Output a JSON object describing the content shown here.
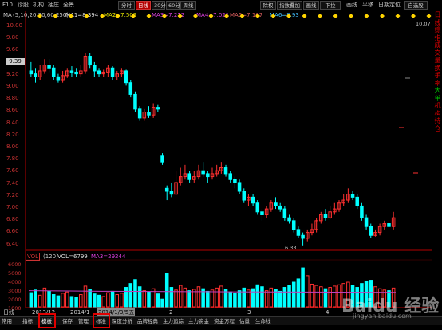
{
  "toolbar": {
    "left_items": [
      "F10",
      "诊股",
      "机构",
      "抽庄",
      "全景"
    ],
    "period_buttons": [
      {
        "label": "分时",
        "active": false
      },
      {
        "label": "日线",
        "active": true
      },
      {
        "label": "30分",
        "active": false
      },
      {
        "label": "60分",
        "active": false
      },
      {
        "label": "周线",
        "active": false
      }
    ],
    "right_items": [
      "除权",
      "指数叠加",
      "画线",
      "下拉",
      "画线",
      "平移",
      "日期定位",
      "自选股"
    ]
  },
  "ma_legend": {
    "label": "MA",
    "params": "(5,10,20,30,60,250)",
    "items": [
      {
        "text": "MA1=8.394",
        "color": "#dcdcdc"
      },
      {
        "text": "MA2=7.509",
        "color": "#e8e800"
      },
      {
        "text": "MA3=7.212",
        "color": "#e040e0"
      },
      {
        "text": "MA4=7.021",
        "color": "#e040e0"
      },
      {
        "text": "MA5=7.167",
        "color": "#e06060"
      },
      {
        "text": "MA6=8.93",
        "color": "#40c0ff"
      }
    ]
  },
  "price_axis": {
    "ticks": [
      "10.00",
      "9.80",
      "9.60",
      "9.40",
      "9.20",
      "9.00",
      "8.80",
      "8.60",
      "8.40",
      "8.20",
      "8.00",
      "7.80",
      "7.60",
      "7.40",
      "7.20",
      "7.00",
      "6.80",
      "6.60",
      "6.40"
    ],
    "current_price": "9.39",
    "high_label": "10.07",
    "low_label": "6.33"
  },
  "volume": {
    "badge": "VOL",
    "period": "(120)",
    "vol_text": "VOL=6799",
    "ma_text": "MA3=29244",
    "ticks": [
      "6000",
      "5000",
      "4000",
      "3000",
      "2000",
      "1000"
    ]
  },
  "dates": [
    "日线",
    "2013/12",
    "2014/1",
    "2014/1/3/5五",
    "2",
    "3",
    "4"
  ],
  "bottom_tabs": [
    "常用",
    "指标",
    "模板",
    "保存",
    "管理",
    "标准",
    "深度分析",
    "品牌经典",
    "主力追踪",
    "主力资金",
    "资金方程",
    "估量",
    "生命线"
  ],
  "right_panel": [
    "日",
    "线",
    "综",
    "指",
    "成",
    "交",
    "量",
    "换",
    "手",
    "率",
    "大",
    "单",
    "机",
    "构",
    "持",
    "仓"
  ],
  "watermark": {
    "main": "Baidu 经验",
    "sub": "jingyan.baidu.com"
  },
  "colors": {
    "up": "#ff3030",
    "down": "#00ffff",
    "axis": "#b40000",
    "highlight": "#e00000"
  },
  "chart_data": {
    "type": "candlestick",
    "y_range": [
      6.3,
      10.1
    ],
    "candles": [
      [
        9.3,
        9.25,
        9.45,
        9.2
      ],
      [
        9.25,
        9.2,
        9.35,
        9.1
      ],
      [
        9.2,
        9.3,
        9.4,
        9.15
      ],
      [
        9.3,
        9.4,
        9.5,
        9.25
      ],
      [
        9.4,
        9.35,
        9.5,
        9.28
      ],
      [
        9.35,
        9.2,
        9.4,
        9.15
      ],
      [
        9.2,
        9.15,
        9.25,
        9.1
      ],
      [
        9.15,
        9.22,
        9.3,
        9.1
      ],
      [
        9.22,
        9.3,
        9.35,
        9.18
      ],
      [
        9.3,
        9.28,
        9.38,
        9.2
      ],
      [
        9.28,
        9.25,
        9.35,
        9.2
      ],
      [
        9.25,
        9.3,
        9.4,
        9.2
      ],
      [
        9.3,
        9.55,
        9.6,
        9.25
      ],
      [
        9.55,
        9.4,
        9.6,
        9.35
      ],
      [
        9.4,
        9.3,
        9.45,
        9.2
      ],
      [
        9.3,
        9.25,
        9.35,
        9.2
      ],
      [
        9.25,
        9.28,
        9.32,
        9.2
      ],
      [
        9.28,
        9.35,
        9.4,
        9.2
      ],
      [
        9.35,
        9.2,
        9.38,
        9.15
      ],
      [
        9.2,
        9.25,
        9.3,
        9.15
      ],
      [
        9.25,
        9.3,
        9.35,
        9.2
      ],
      [
        9.3,
        9.1,
        9.32,
        9.05
      ],
      [
        9.1,
        8.9,
        9.15,
        8.85
      ],
      [
        8.9,
        8.65,
        8.95,
        8.6
      ],
      [
        8.65,
        8.5,
        8.7,
        8.45
      ],
      [
        8.5,
        8.6,
        8.65,
        8.45
      ],
      [
        8.6,
        8.55,
        8.7,
        8.5
      ],
      [
        8.55,
        8.68,
        8.75,
        8.5
      ],
      [
        8.68,
        8.65,
        8.72,
        8.6
      ],
      [
        7.85,
        7.75,
        7.9,
        7.7
      ],
      [
        7.3,
        7.25,
        7.35,
        7.1
      ],
      [
        7.25,
        7.2,
        7.4,
        7.15
      ],
      [
        7.2,
        7.4,
        7.6,
        7.18
      ],
      [
        7.4,
        7.5,
        7.65,
        7.35
      ],
      [
        7.5,
        7.55,
        7.7,
        7.45
      ],
      [
        7.55,
        7.45,
        7.6,
        7.4
      ],
      [
        7.45,
        7.5,
        7.6,
        7.4
      ],
      [
        7.5,
        7.6,
        7.7,
        7.45
      ],
      [
        7.6,
        7.55,
        7.75,
        7.5
      ],
      [
        7.55,
        7.5,
        7.6,
        7.4
      ],
      [
        7.5,
        7.55,
        7.65,
        7.45
      ],
      [
        7.55,
        7.6,
        7.7,
        7.5
      ],
      [
        7.6,
        7.65,
        7.75,
        7.55
      ],
      [
        7.65,
        7.55,
        7.7,
        7.5
      ],
      [
        7.55,
        7.45,
        7.6,
        7.4
      ],
      [
        7.45,
        7.4,
        7.5,
        7.3
      ],
      [
        7.4,
        7.25,
        7.45,
        7.2
      ],
      [
        7.25,
        7.1,
        7.3,
        7.05
      ],
      [
        7.1,
        7.15,
        7.2,
        7.0
      ],
      [
        7.15,
        7.05,
        7.2,
        7.0
      ],
      [
        7.05,
        6.9,
        7.1,
        6.85
      ],
      [
        6.9,
        6.85,
        6.95,
        6.75
      ],
      [
        6.85,
        6.95,
        7.0,
        6.8
      ],
      [
        6.95,
        7.05,
        7.1,
        6.9
      ],
      [
        7.05,
        7.0,
        7.15,
        6.95
      ],
      [
        7.0,
        6.95,
        7.05,
        6.9
      ],
      [
        6.95,
        6.8,
        7.0,
        6.75
      ],
      [
        6.8,
        6.75,
        6.85,
        6.7
      ],
      [
        6.75,
        6.6,
        6.8,
        6.55
      ],
      [
        6.6,
        6.5,
        6.65,
        6.45
      ],
      [
        6.5,
        6.45,
        6.55,
        6.33
      ],
      [
        6.45,
        6.55,
        6.6,
        6.4
      ],
      [
        6.55,
        6.6,
        6.7,
        6.5
      ],
      [
        6.6,
        6.75,
        6.8,
        6.55
      ],
      [
        6.75,
        6.85,
        6.9,
        6.7
      ],
      [
        6.85,
        6.8,
        6.95,
        6.75
      ],
      [
        6.8,
        6.9,
        7.0,
        6.78
      ],
      [
        6.9,
        6.95,
        7.05,
        6.85
      ],
      [
        6.95,
        7.05,
        7.1,
        6.9
      ],
      [
        7.05,
        7.1,
        7.2,
        7.0
      ],
      [
        7.1,
        7.2,
        7.3,
        7.05
      ],
      [
        7.2,
        7.15,
        7.25,
        7.1
      ],
      [
        7.15,
        7.0,
        7.2,
        6.95
      ],
      [
        7.0,
        6.8,
        7.05,
        6.75
      ],
      [
        6.8,
        6.65,
        6.85,
        6.6
      ],
      [
        6.65,
        6.5,
        6.7,
        6.45
      ],
      [
        6.5,
        6.55,
        6.6,
        6.48
      ],
      [
        6.55,
        6.65,
        6.7,
        6.5
      ],
      [
        6.65,
        6.7,
        6.75,
        6.6
      ],
      [
        6.7,
        6.65,
        6.75,
        6.6
      ],
      [
        6.65,
        6.8,
        6.9,
        6.6
      ]
    ],
    "volumes": [
      2200,
      2600,
      1800,
      2900,
      2400,
      1900,
      1700,
      2100,
      2300,
      1600,
      1500,
      1900,
      3200,
      2700,
      2000,
      1800,
      1600,
      2200,
      2400,
      1900,
      2100,
      3000,
      3600,
      4200,
      3100,
      2500,
      2300,
      2800,
      2000,
      1200,
      5200,
      3000,
      2600,
      3300,
      2900,
      2500,
      2700,
      3100,
      2800,
      2400,
      2600,
      2900,
      3200,
      2700,
      2300,
      2100,
      2500,
      2900,
      2600,
      2800,
      3400,
      3100,
      2500,
      2900,
      2700,
      2400,
      3000,
      3300,
      3800,
      4300,
      6000,
      4800,
      3500,
      3300,
      3100,
      2800,
      3000,
      3200,
      3400,
      3600,
      3800,
      3300,
      3000,
      3600,
      3900,
      4100,
      3100,
      2800,
      2600,
      2500,
      2900
    ],
    "vol_ma_line": [
      2500,
      2450,
      2400,
      2380,
      2350,
      2320,
      2300,
      2280,
      2260,
      2240
    ]
  }
}
